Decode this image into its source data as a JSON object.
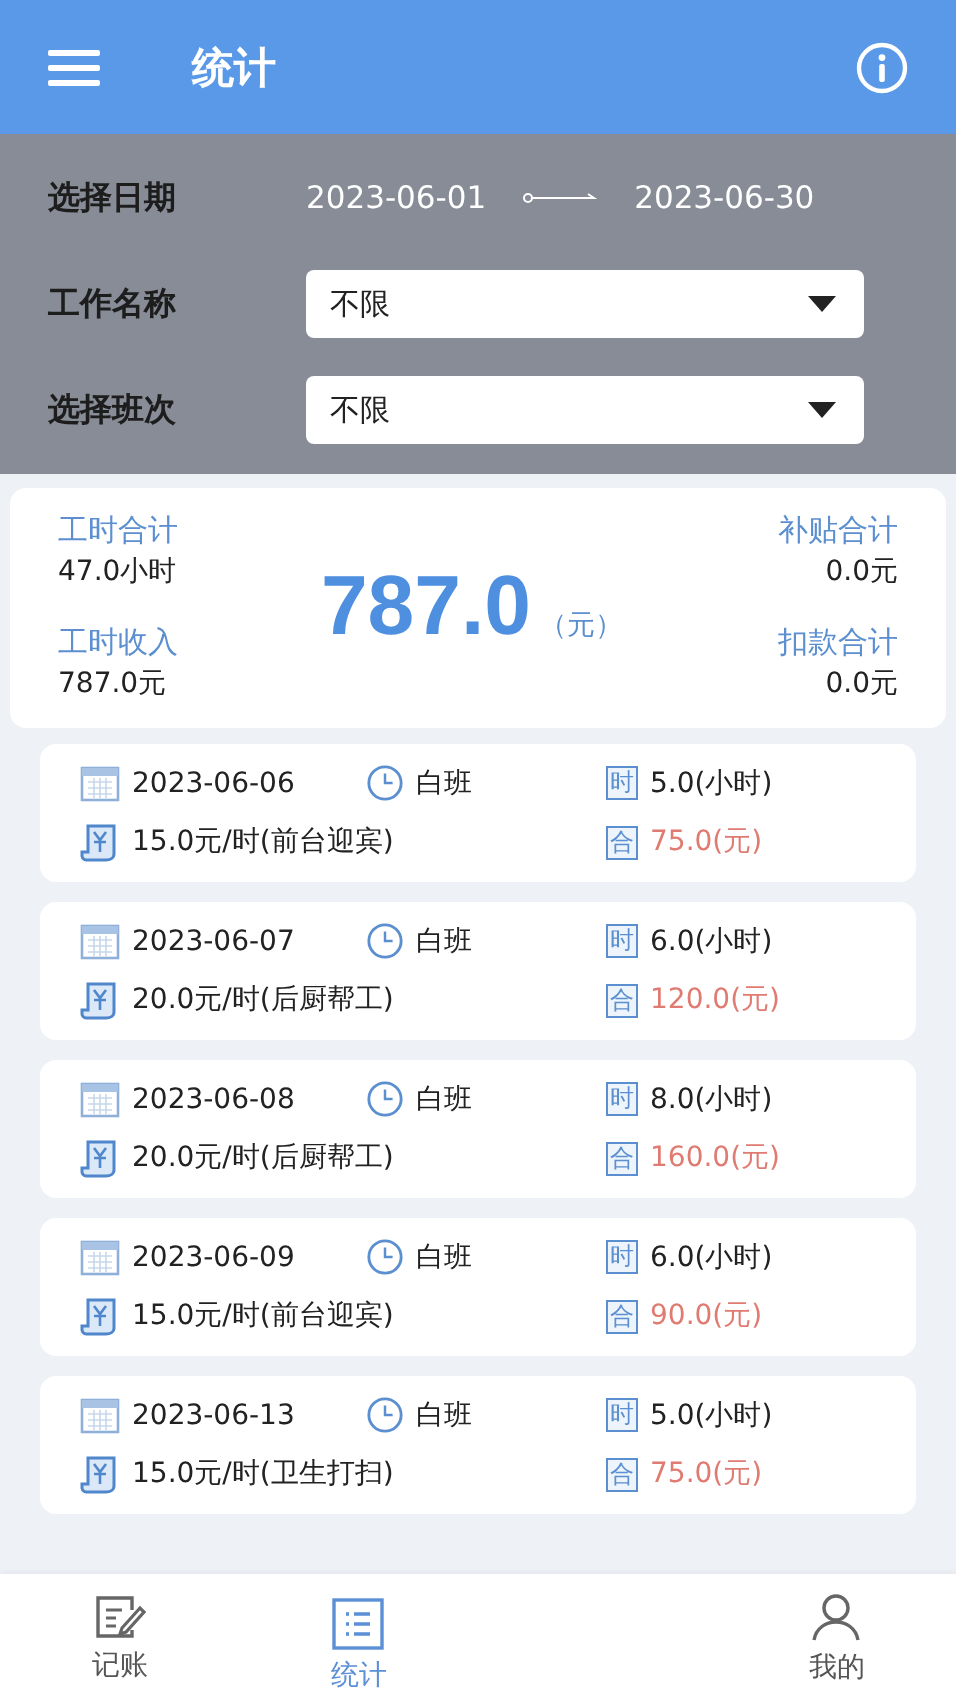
{
  "app_bar": {
    "title": "统计"
  },
  "filters": {
    "date_label": "选择日期",
    "start_date": "2023-06-01",
    "end_date": "2023-06-30",
    "selects": [
      {
        "label": "工作名称",
        "value": "不限"
      },
      {
        "label": "选择班次",
        "value": "不限"
      }
    ]
  },
  "summary": {
    "hours_label": "工时合计",
    "hours": "47.0小时",
    "income_label": "工时收入",
    "income": "787.0元",
    "total": "787.0",
    "total_unit": "（元）",
    "subsidy_label": "补贴合计",
    "subsidy": "0.0元",
    "deduction_label": "扣款合计",
    "deduction": "0.0元"
  },
  "records": [
    {
      "date": "2023-06-06",
      "shift": "白班",
      "hours_badge": "时",
      "hours": "5.0(小时)",
      "rate": "15.0元/时(前台迎宾)",
      "total_badge": "合",
      "amount": "75.0(元)"
    },
    {
      "date": "2023-06-07",
      "shift": "白班",
      "hours_badge": "时",
      "hours": "6.0(小时)",
      "rate": "20.0元/时(后厨帮工)",
      "total_badge": "合",
      "amount": "120.0(元)"
    },
    {
      "date": "2023-06-08",
      "shift": "白班",
      "hours_badge": "时",
      "hours": "8.0(小时)",
      "rate": "20.0元/时(后厨帮工)",
      "total_badge": "合",
      "amount": "160.0(元)"
    },
    {
      "date": "2023-06-09",
      "shift": "白班",
      "hours_badge": "时",
      "hours": "6.0(小时)",
      "rate": "15.0元/时(前台迎宾)",
      "total_badge": "合",
      "amount": "90.0(元)"
    },
    {
      "date": "2023-06-13",
      "shift": "白班",
      "hours_badge": "时",
      "hours": "5.0(小时)",
      "rate": "15.0元/时(卫生打扫)",
      "total_badge": "合",
      "amount": "75.0(元)"
    }
  ],
  "nav": [
    {
      "kind": "edit",
      "label": "记账",
      "selected": false
    },
    {
      "kind": "list",
      "label": "统计",
      "selected": true
    },
    {
      "kind": "person",
      "label": "我的",
      "selected": false
    }
  ]
}
